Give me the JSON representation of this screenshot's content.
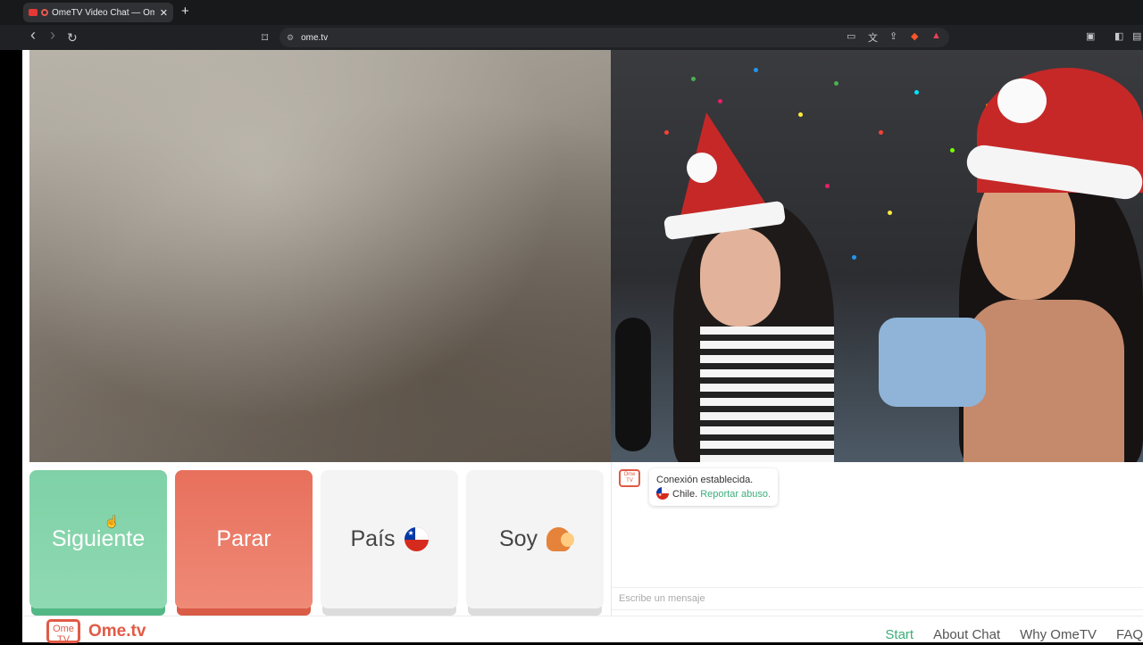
{
  "browser": {
    "tab_title": "OmeTV Video Chat — Omegl",
    "tab_close": "✕",
    "new_tab": "+",
    "back": "‹",
    "forward": "›",
    "reload": "↻",
    "bookmark": "⌑",
    "url": "ome.tv"
  },
  "controls": {
    "next_label": "Siguiente",
    "stop_label": "Parar",
    "country_label": "País",
    "gender_label": "Soy"
  },
  "chat": {
    "logo_text": "Ome TV",
    "status_message": "Conexión establecida.",
    "country_text": "Chile.",
    "report_link": "Reportar abuso.",
    "input_placeholder": "Escribe un mensaje"
  },
  "footer": {
    "logo_tv": "Ome TV",
    "brand": "Ome.tv",
    "nav": [
      "Start",
      "About Chat",
      "Why OmeTV",
      "FAQ"
    ]
  },
  "colors": {
    "next": "#7fd1a7",
    "stop": "#e7705c",
    "brand": "#e25a45",
    "link_green": "#3cae7a"
  }
}
